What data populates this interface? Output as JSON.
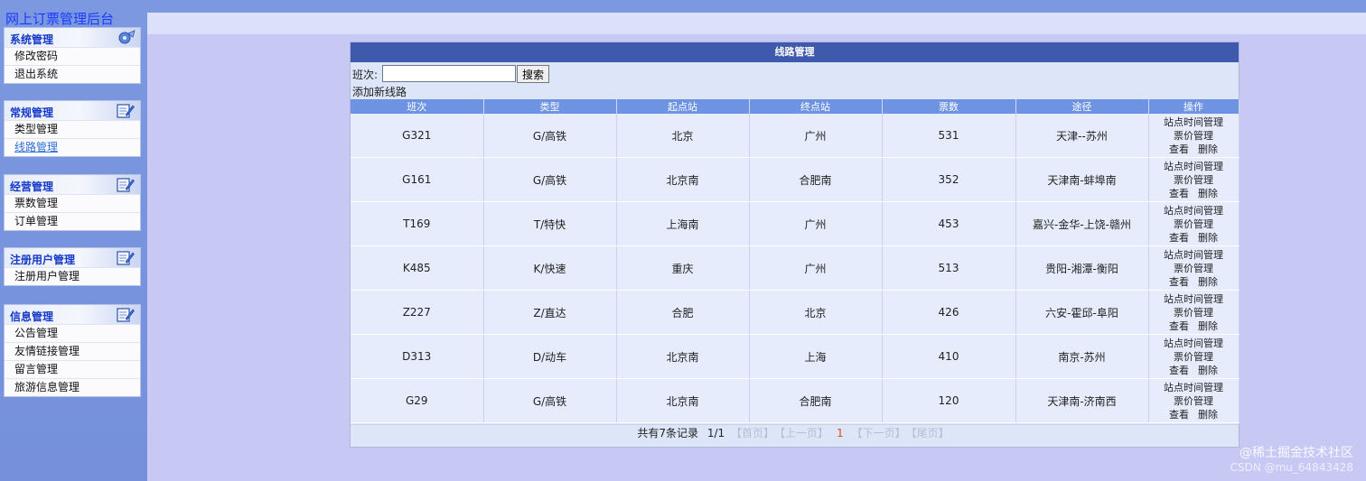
{
  "site_title": "网上订票管理后台",
  "sidebar": {
    "groups": [
      {
        "title": "系统管理",
        "icon": "gear-icon",
        "items": [
          "修改密码",
          "退出系统"
        ]
      },
      {
        "title": "常规管理",
        "icon": "edit-icon",
        "items": [
          "类型管理",
          "线路管理"
        ],
        "active": "线路管理"
      },
      {
        "title": "经营管理",
        "icon": "edit-icon",
        "items": [
          "票数管理",
          "订单管理"
        ]
      },
      {
        "title": "注册用户管理",
        "icon": "edit-icon",
        "items": [
          "注册用户管理"
        ]
      },
      {
        "title": "信息管理",
        "icon": "edit-icon",
        "items": [
          "公告管理",
          "友情链接管理",
          "留言管理",
          "旅游信息管理"
        ]
      }
    ]
  },
  "panel": {
    "title": "线路管理",
    "search": {
      "label": "班次:",
      "value": "",
      "button": "搜索"
    },
    "add_link": "添加新线路",
    "columns": [
      "班次",
      "类型",
      "起点站",
      "终点站",
      "票数",
      "途径",
      "操作"
    ],
    "rows": [
      {
        "train": "G321",
        "type": "G/高铁",
        "from": "北京",
        "to": "广州",
        "tickets": "531",
        "via": "天津--苏州"
      },
      {
        "train": "G161",
        "type": "G/高铁",
        "from": "北京南",
        "to": "合肥南",
        "tickets": "352",
        "via": "天津南-蚌埠南"
      },
      {
        "train": "T169",
        "type": "T/特快",
        "from": "上海南",
        "to": "广州",
        "tickets": "453",
        "via": "嘉兴-金华-上饶-赣州"
      },
      {
        "train": "K485",
        "type": "K/快速",
        "from": "重庆",
        "to": "广州",
        "tickets": "513",
        "via": "贵阳-湘潭-衡阳"
      },
      {
        "train": "Z227",
        "type": "Z/直达",
        "from": "合肥",
        "to": "北京",
        "tickets": "426",
        "via": "六安-霍邱-阜阳"
      },
      {
        "train": "D313",
        "type": "D/动车",
        "from": "北京南",
        "to": "上海",
        "tickets": "410",
        "via": "南京-苏州"
      },
      {
        "train": "G29",
        "type": "G/高铁",
        "from": "北京南",
        "to": "合肥南",
        "tickets": "120",
        "via": "天津南-济南西"
      }
    ],
    "row_actions": {
      "station_time": "站点时间管理",
      "price": "票价管理",
      "view": "查看",
      "delete": "删除"
    },
    "pager": {
      "summary": "共有7条记录",
      "page_info": "1/1",
      "first": "【首页】",
      "prev": "【上一页】",
      "current": "1",
      "next": "【下一页】",
      "last": "【尾页】"
    }
  },
  "watermark": {
    "line1": "@稀土掘金技术社区",
    "line2": "CSDN @mu_64843428"
  },
  "colors": {
    "sidebar_bg": "#7b98e0",
    "page_bg": "#c7c9f4",
    "panel_header": "#3f5aac",
    "table_header": "#6e93e2",
    "menu_head_text": "#1438c8",
    "pager_current": "#e04b1f"
  }
}
